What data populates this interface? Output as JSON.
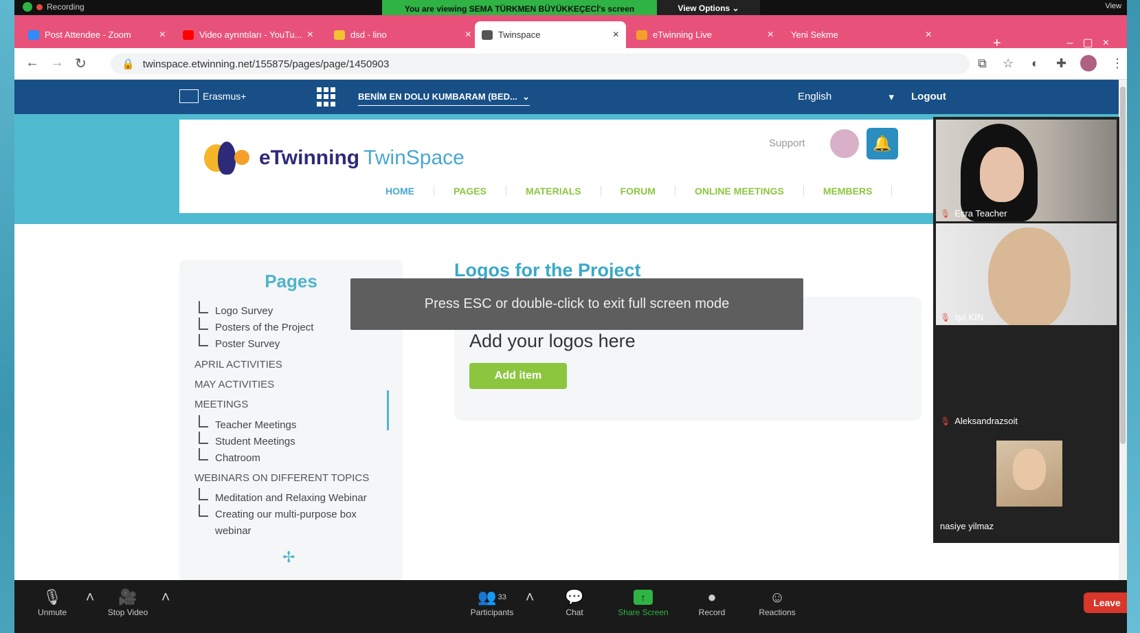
{
  "zoom_top": {
    "recording": "Recording",
    "viewing_banner": "You are viewing SEMA TÜRKMEN BÜYÜKKEÇECİ's screen",
    "view_options": "View Options",
    "view": "View"
  },
  "tabs": [
    {
      "title": "Post Attendee - Zoom",
      "color": "#2d8cff"
    },
    {
      "title": "Video ayrıntıları - YouTu...",
      "color": "#ff0000"
    },
    {
      "title": "dsd - lino",
      "color": "#f1c232"
    },
    {
      "title": "Twinspace",
      "color": "#555555"
    },
    {
      "title": "eTwinning Live",
      "color": "#f3a02a"
    },
    {
      "title": "Yeni Sekme",
      "color": ""
    }
  ],
  "address": {
    "url": "twinspace.etwinning.net/155875/pages/page/1450903"
  },
  "site": {
    "erasmus": "Erasmus+",
    "project": "BENİM EN DOLU KUMBARAM (BED...",
    "language": "English",
    "logout": "Logout",
    "logo_part1": "eTwinning",
    "logo_part2": "TwinSpace",
    "support": "Support",
    "nav": [
      "HOME",
      "PAGES",
      "MATERIALS",
      "FORUM",
      "ONLINE MEETINGS",
      "MEMBERS"
    ]
  },
  "sidebar": {
    "title": "Pages",
    "items": [
      "Logo Survey",
      "Posters of the Project",
      "Poster Survey",
      "APRIL ACTIVITIES",
      "MAY ACTIVITIES",
      "MEETINGS",
      "Teacher Meetings",
      "Student Meetings",
      "Chatroom",
      "WEBINARS ON DIFFERENT TOPICS",
      "Meditation and Relaxing Webinar",
      "Creating our multi-purpose box",
      "webinar"
    ]
  },
  "content": {
    "title": "Logos for the Project",
    "heading": "Add your logos here",
    "add_item": "Add item"
  },
  "fullscreen_notice": "Press ESC or double-click to exit full screen mode",
  "participants": [
    "Esra Teacher",
    "Işıl KIN",
    "Aleksandrazsoit",
    "nasiye yilmaz"
  ],
  "zoom_bottom": {
    "unmute": "Unmute",
    "stop_video": "Stop Video",
    "participants": "Participants",
    "participants_count": "33",
    "chat": "Chat",
    "share_screen": "Share Screen",
    "record": "Record",
    "reactions": "Reactions",
    "leave": "Leave"
  }
}
